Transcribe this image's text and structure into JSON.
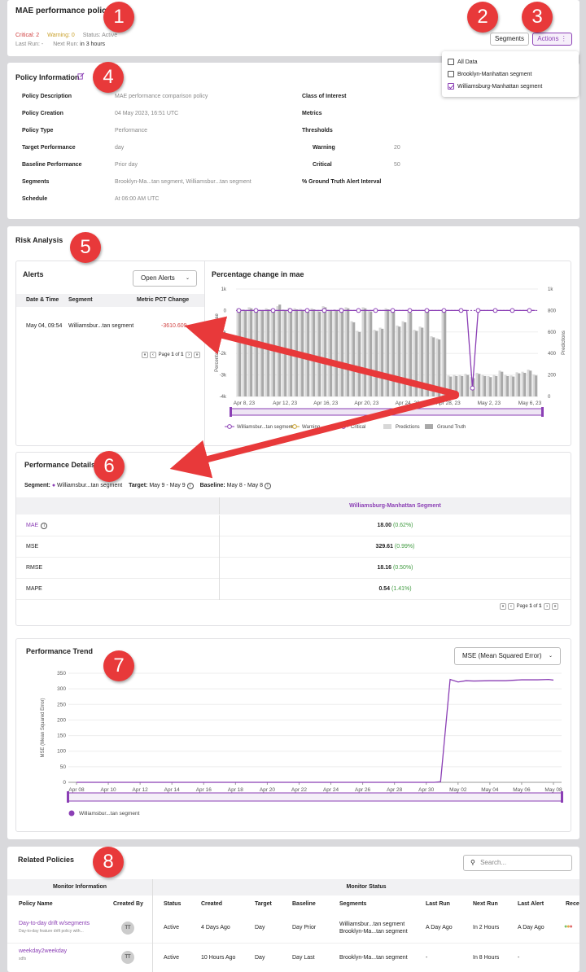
{
  "header": {
    "title": "MAE performance policy",
    "critical_label": "Critical:",
    "critical_value": "2",
    "warning_label": "Warning:",
    "warning_value": "0",
    "status_label": "Status:",
    "status_value": "Active",
    "last_run_label": "Last Run:",
    "last_run_value": "-",
    "next_run_label": "Next Run:",
    "next_run_value": "in 3 hours",
    "segments_btn": "Segments",
    "actions_btn": "Actions"
  },
  "segments_menu": {
    "items": [
      {
        "label": "All Data",
        "checked": false
      },
      {
        "label": "Brooklyn-Manhattan segment",
        "checked": false
      },
      {
        "label": "Williamsburg-Manhattan segment",
        "checked": true
      }
    ]
  },
  "policy_info": {
    "title": "Policy Information",
    "left": [
      {
        "k": "Policy Description",
        "v": "MAE performance comparison policy"
      },
      {
        "k": "Policy Creation",
        "v": "04 May 2023, 16:51 UTC"
      },
      {
        "k": "Policy Type",
        "v": "Performance"
      },
      {
        "k": "Target Performance",
        "v": "day"
      },
      {
        "k": "Baseline Performance",
        "v": "Prior day"
      },
      {
        "k": "Segments",
        "v": "Brooklyn-Ma...tan segment, Williamsbur...tan segment"
      },
      {
        "k": "Schedule",
        "v": "At 06:00 AM UTC"
      }
    ],
    "right": {
      "class_label": "Class of Interest",
      "metrics_label": "Metrics",
      "thresholds_label": "Thresholds",
      "warning_label": "Warning",
      "warning_value": "20",
      "critical_label": "Critical",
      "critical_value": "50",
      "gt_label": "% Ground Truth Alert Interval"
    }
  },
  "risk": {
    "title": "Risk Analysis",
    "alerts_title": "Alerts",
    "filter": "Open Alerts",
    "columns": [
      "Date & Time",
      "Segment",
      "Metric PCT Change"
    ],
    "rows": [
      {
        "date": "May 04, 09:54",
        "segment": "Williamsbur...tan segment",
        "change": "-3610.609"
      }
    ],
    "page_label": "Page",
    "page": "1",
    "of": "of",
    "pages": "1"
  },
  "chart_data": [
    {
      "type": "bar",
      "title": "Percentage change in mae",
      "ylabel": "Percentage change in mae",
      "y2label": "Predictions",
      "categories": [
        "Apr 8, 23",
        "Apr 12, 23",
        "Apr 16, 23",
        "Apr 20, 23",
        "Apr 24, 23",
        "Apr 28, 23",
        "May 2, 23",
        "May 6, 23"
      ],
      "ylim": [
        -4000,
        1000
      ],
      "yticks": [
        "1k",
        "0",
        "-1k",
        "-2k",
        "-3k",
        "-4k"
      ],
      "y2lim": [
        0,
        1000
      ],
      "y2ticks": [
        "1k",
        "800",
        "600",
        "400",
        "200",
        "0"
      ],
      "series": [
        {
          "name": "Predictions",
          "values": [
            820,
            810,
            830,
            810,
            805,
            820,
            815,
            840,
            810,
            825,
            820,
            815,
            800,
            820,
            800,
            840,
            805,
            810,
            825,
            830,
            700,
            610,
            830,
            800,
            620,
            640,
            820,
            800,
            660,
            700,
            790,
            620,
            650,
            810,
            560,
            540,
            810,
            195,
            200,
            200,
            210,
            180,
            220,
            200,
            190,
            200,
            240,
            200,
            195,
            225,
            230,
            250,
            205
          ]
        },
        {
          "name": "Ground Truth",
          "values": [
            810,
            800,
            820,
            800,
            800,
            810,
            805,
            855,
            800,
            815,
            810,
            805,
            790,
            810,
            790,
            830,
            795,
            800,
            815,
            820,
            690,
            600,
            820,
            790,
            610,
            630,
            810,
            790,
            650,
            690,
            780,
            610,
            640,
            800,
            550,
            530,
            800,
            185,
            190,
            190,
            200,
            170,
            210,
            190,
            180,
            190,
            230,
            190,
            185,
            215,
            220,
            240,
            195
          ]
        },
        {
          "name": "Williamsbur...tan segment",
          "values": [
            0,
            0,
            0,
            0,
            0,
            0,
            0,
            0,
            0,
            0,
            0,
            0,
            0,
            0,
            0,
            0,
            0,
            0,
            0,
            0,
            0,
            0,
            0,
            0,
            0,
            0,
            0,
            0,
            0,
            0,
            0,
            0,
            0,
            0,
            0,
            0,
            0,
            0,
            0,
            0,
            0,
            -3610,
            0,
            0,
            0,
            0,
            0,
            0,
            0,
            0,
            0,
            0,
            0
          ]
        },
        {
          "name": "Critical",
          "values": []
        }
      ],
      "legend": [
        "Williamsbur...tan segment",
        "Warning",
        "Critical",
        "Predictions",
        "Ground Truth"
      ]
    },
    {
      "type": "line",
      "title": "Performance Trend",
      "ylabel": "MSE (Mean Squared Error)",
      "ylim": [
        0,
        350
      ],
      "yticks": [
        "350",
        "300",
        "250",
        "200",
        "150",
        "100",
        "50",
        "0"
      ],
      "categories": [
        "Apr 08",
        "Apr 10",
        "Apr 12",
        "Apr 14",
        "Apr 16",
        "Apr 18",
        "Apr 20",
        "Apr 22",
        "Apr 24",
        "Apr 26",
        "Apr 28",
        "Apr 30",
        "May 02",
        "May 04",
        "May 06",
        "May 08"
      ],
      "series": [
        {
          "name": "Williamsbur...tan segment",
          "x": [
            0,
            22.5,
            22.9,
            23.5,
            24,
            24.5,
            25,
            26,
            27,
            28,
            29,
            29.7,
            30
          ],
          "values": [
            0,
            0,
            2,
            330,
            322,
            326,
            325,
            326,
            326,
            329,
            329,
            330,
            328
          ]
        }
      ]
    }
  ],
  "perf": {
    "title": "Performance Details",
    "segment_label": "Segment:",
    "segment_value": "Williamsbur...tan segment",
    "target_label": "Target:",
    "target_value": "May 9 - May 9",
    "baseline_label": "Baseline:",
    "baseline_value": "May 8 - May 8",
    "column": "Williamsburg-Manhattan Segment",
    "rows": [
      {
        "metric": "MAE",
        "value": "18.00",
        "pct": "(0.62%)"
      },
      {
        "metric": "MSE",
        "value": "329.61",
        "pct": "(0.99%)"
      },
      {
        "metric": "RMSE",
        "value": "18.16",
        "pct": "(0.50%)"
      },
      {
        "metric": "MAPE",
        "value": "0.54",
        "pct": "(1.41%)"
      }
    ],
    "page_label": "Page",
    "page": "1",
    "of": "of",
    "pages": "1"
  },
  "trend": {
    "title": "Performance Trend",
    "select": "MSE (Mean Squared Error)",
    "legend": "Williamsbur...tan segment"
  },
  "related": {
    "title": "Related Policies",
    "search_placeholder": "Search...",
    "group1": "Monitor Information",
    "group2": "Monitor Status",
    "columns": [
      "Policy Name",
      "Created By",
      "Status",
      "Created",
      "Target",
      "Baseline",
      "Segments",
      "Last Run",
      "Next Run",
      "Last Alert",
      "Rece"
    ],
    "rows": [
      {
        "name": "Day-to-day drift w/segments",
        "desc": "Day-to-day feature drift policy with...",
        "by": "TT",
        "status": "Active",
        "created": "4 Days Ago",
        "target": "Day",
        "baseline": "Day Prior",
        "seg1": "Williamsbur...tan segment",
        "seg2": "Brooklyn-Ma...tan segment",
        "last_run": "A Day Ago",
        "next_run": "In 2 Hours",
        "last_alert": "A Day Ago"
      },
      {
        "name": "weekday2weekday",
        "desc": "sdfs",
        "by": "TT",
        "status": "Active",
        "created": "10 Hours Ago",
        "target": "Day",
        "baseline": "Day Last",
        "seg1": "Brooklyn-Ma...tan segment",
        "seg2": "",
        "last_run": "-",
        "next_run": "In 8 Hours",
        "last_alert": "-"
      }
    ]
  },
  "badges": [
    "1",
    "2",
    "3",
    "4",
    "5",
    "6",
    "7",
    "8"
  ],
  "colors": {
    "accent": "#8b3fb5",
    "badge": "#e8393a",
    "critical": "#d04040",
    "warning": "#c9a02a",
    "positive": "#3f9a3f"
  }
}
